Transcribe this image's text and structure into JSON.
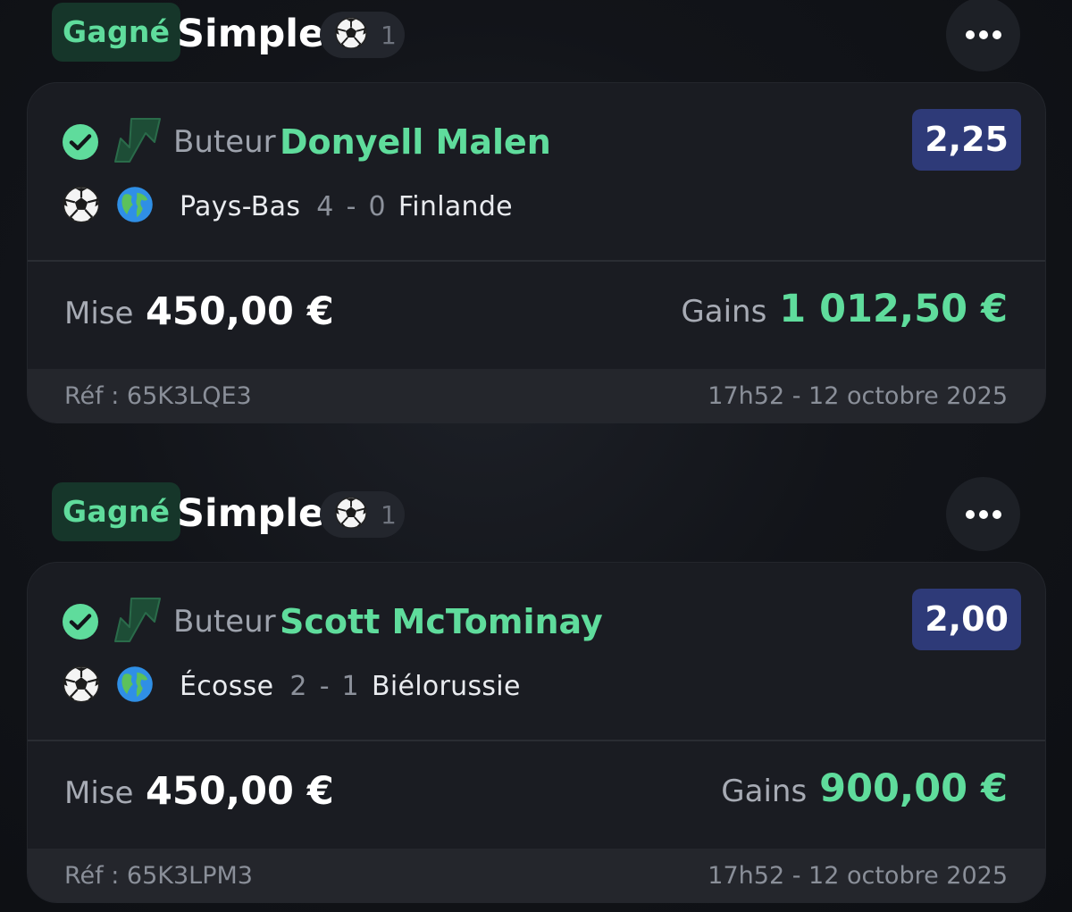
{
  "colors": {
    "win_green": "#5fdc9c",
    "win_badge_bg": "#16362a",
    "odds_bg": "#2e3a78",
    "card_bg": "#1a1c22",
    "footer_bg": "#24262c"
  },
  "icons": {
    "more": "more-horizontal-icon",
    "sport": "soccer-ball-icon",
    "check": "check-circle-icon",
    "boost": "boost-arrow-icon",
    "globe": "globe-icon"
  },
  "bets": [
    {
      "status": "Gagné",
      "type": "Simple",
      "selection_count": "1",
      "market": "Buteur",
      "player": "Donyell Malen",
      "odds": "2,25",
      "home_team": "Pays-Bas",
      "home_score": "4",
      "score_separator": "-",
      "away_score": "0",
      "away_team": "Finlande",
      "stake_label": "Mise",
      "stake": "450,00 €",
      "gains_label": "Gains",
      "gains": "1 012,50 €",
      "reference": "Réf : 65K3LQE3",
      "datetime": "17h52 - 12 octobre 2025"
    },
    {
      "status": "Gagné",
      "type": "Simple",
      "selection_count": "1",
      "market": "Buteur",
      "player": "Scott McTominay",
      "odds": "2,00",
      "home_team": "Écosse",
      "home_score": "2",
      "score_separator": "-",
      "away_score": "1",
      "away_team": "Biélorussie",
      "stake_label": "Mise",
      "stake": "450,00 €",
      "gains_label": "Gains",
      "gains": "900,00 €",
      "reference": "Réf : 65K3LPM3",
      "datetime": "17h52 - 12 octobre 2025"
    }
  ]
}
